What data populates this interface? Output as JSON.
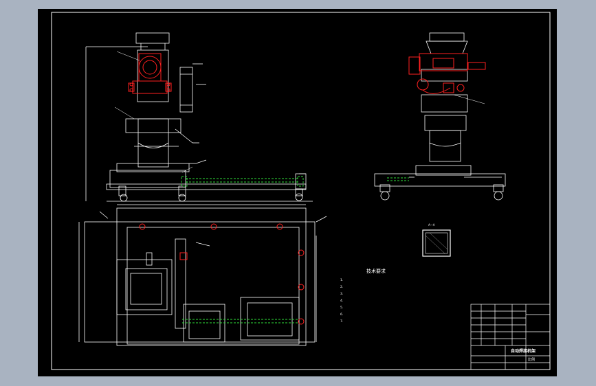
{
  "drawing": {
    "colors": {
      "background": "#000000",
      "outline": "#ffffff",
      "highlight": "#ff2020",
      "hidden_line": "#2fe03a",
      "window_frame": "#a9b3c1"
    }
  },
  "section_label": "A—A",
  "notes": {
    "title": "技术要求",
    "lines": [
      "1.",
      "2.",
      "3.",
      "4.",
      "5.",
      "6.",
      "7."
    ]
  },
  "title_block": {
    "drawing_name": "自动焊接机架",
    "scale_label": "比例",
    "rows": [
      "",
      "",
      "",
      "",
      "",
      ""
    ]
  }
}
